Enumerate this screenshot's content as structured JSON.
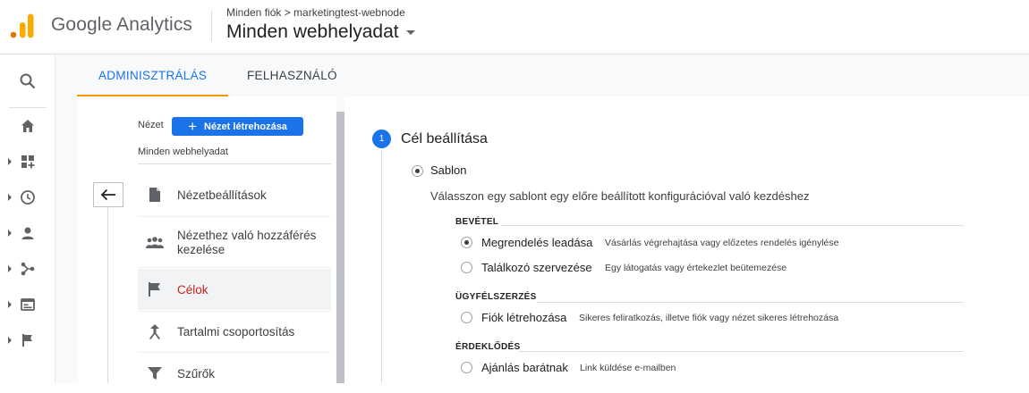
{
  "app": {
    "title": "Google Analytics",
    "breadcrumb": "Minden fiók > marketingtest-webnode",
    "view_name": "Minden webhelyadat"
  },
  "tabs": [
    {
      "label": "ADMINISZTRÁLÁS",
      "active": true
    },
    {
      "label": "FELHASZNÁLÓ",
      "active": false
    }
  ],
  "rail": {
    "icons": [
      "search-icon",
      "home-icon",
      "dashboard-add-icon",
      "clock-icon",
      "person-icon",
      "acquisition-icon",
      "display-icon",
      "flag-icon"
    ]
  },
  "view_column": {
    "label": "Nézet",
    "create_button": "Nézet létrehozása",
    "selected_view": "Minden webhelyadat",
    "items": [
      {
        "label": "Nézetbeállítások",
        "icon": "document-icon",
        "active": false
      },
      {
        "label": "Nézethez való hozzáférés kezelése",
        "icon": "people-icon",
        "active": false
      },
      {
        "label": "Célok",
        "icon": "flag-icon",
        "active": true
      },
      {
        "label": "Tartalmi csoportosítás",
        "icon": "grouping-icon",
        "active": false
      },
      {
        "label": "Szűrők",
        "icon": "filter-icon",
        "active": false
      }
    ]
  },
  "goal_setup": {
    "step_number": "1",
    "step_title": "Cél beállítása",
    "template_option": "Sablon",
    "template_description": "Válasszon egy sablont egy előre beállított konfigurációval való kezdéshez",
    "categories": [
      {
        "name": "BEVÉTEL",
        "options": [
          {
            "label": "Megrendelés leadása",
            "description": "Vásárlás végrehajtása vagy előzetes rendelés igénylése",
            "selected": true
          },
          {
            "label": "Találkozó szervezése",
            "description": "Egy látogatás vagy értekezlet beütemezése",
            "selected": false
          }
        ]
      },
      {
        "name": "ÜGYFÉLSZERZÉS",
        "options": [
          {
            "label": "Fiók létrehozása",
            "description": "Sikeres feliratkozás, illetve fiók vagy nézet sikeres létrehozása",
            "selected": false
          }
        ]
      },
      {
        "name": "ÉRDEKLŐDÉS",
        "options": [
          {
            "label": "Ajánlás barátnak",
            "description": "Link küldése e-mailben",
            "selected": false
          }
        ]
      }
    ]
  },
  "colors": {
    "accent": "#1a73e8",
    "tab_underline": "#f29900",
    "active_item_text": "#c5221f"
  }
}
